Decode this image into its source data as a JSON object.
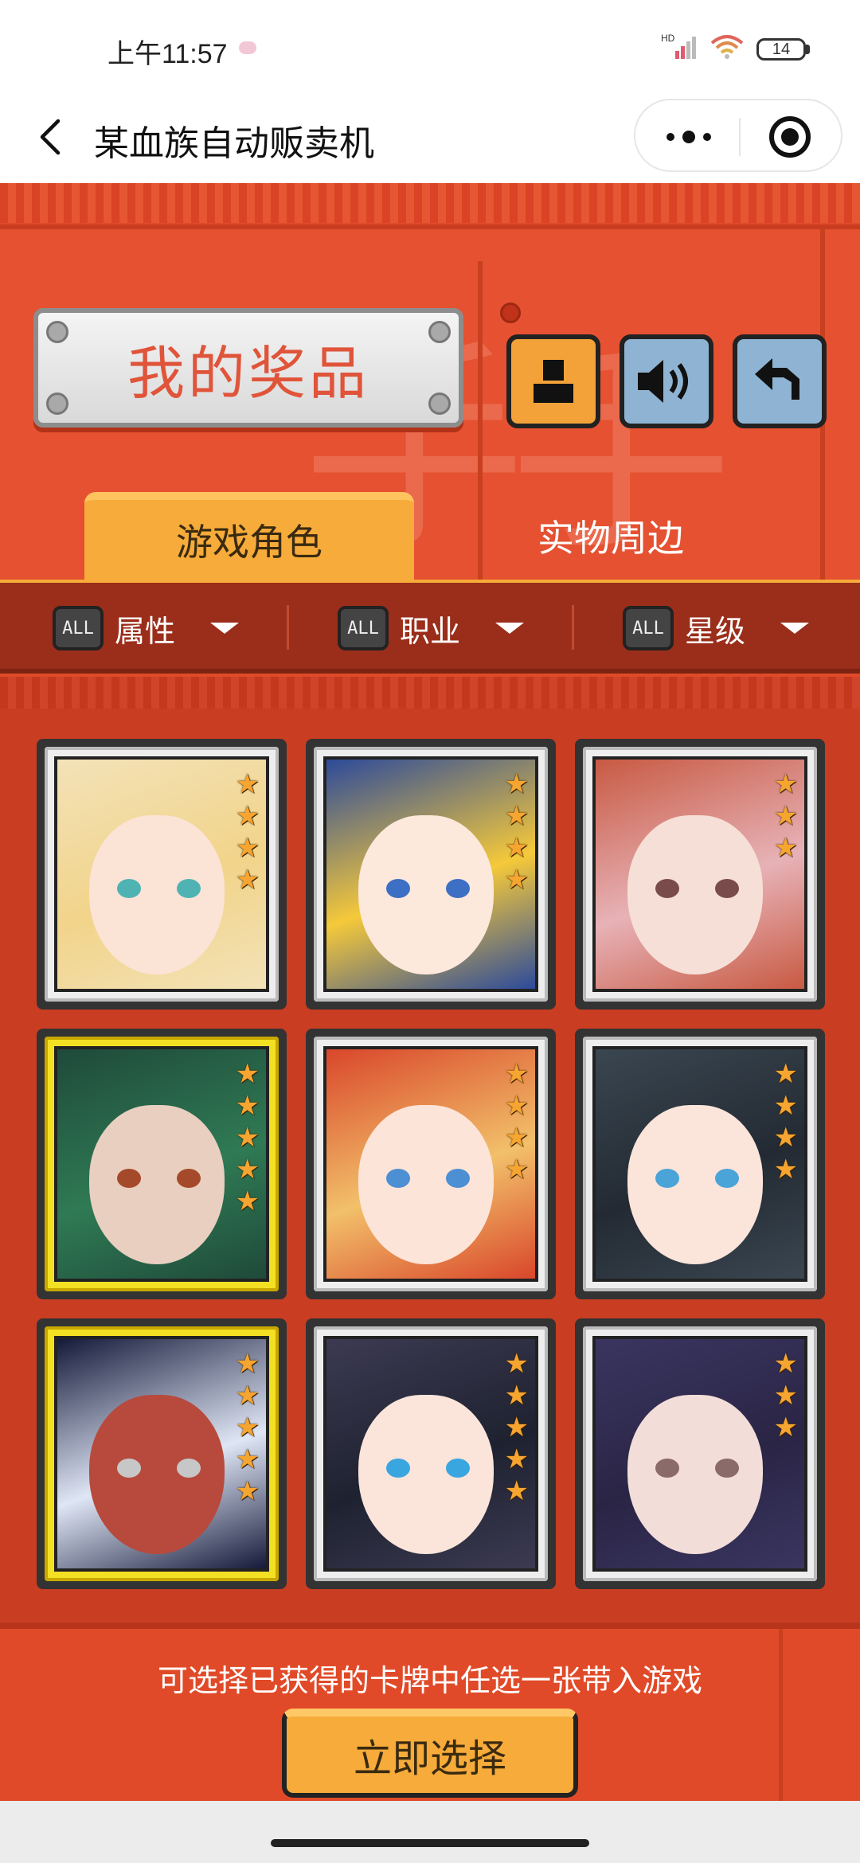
{
  "status_bar": {
    "time": "上午11:57",
    "signal_label": "HD",
    "battery": "14"
  },
  "nav": {
    "title": "某血族自动贩卖机"
  },
  "header": {
    "prize_label": "我的奖品"
  },
  "tabs": [
    {
      "label": "游戏角色",
      "active": true
    },
    {
      "label": "实物周边",
      "active": false
    }
  ],
  "filters": [
    {
      "badge": "ALL",
      "label": "属性"
    },
    {
      "badge": "ALL",
      "label": "职业"
    },
    {
      "badge": "ALL",
      "label": "星级"
    }
  ],
  "cards": [
    {
      "stars": 4,
      "frame": "silver",
      "palette": {
        "bg": "#f3e2b8",
        "hair": "#f2d48a",
        "skin": "#fbe3d6",
        "eye": "#4fb3b3"
      }
    },
    {
      "stars": 4,
      "frame": "silver",
      "palette": {
        "bg": "#2c4a9a",
        "hair": "#f5c93a",
        "skin": "#fde8dc",
        "eye": "#3d6fc4"
      }
    },
    {
      "stars": 3,
      "frame": "silver",
      "palette": {
        "bg": "#c85a43",
        "hair": "#e7b2b7",
        "skin": "#f6dfd6",
        "eye": "#7a4b4b"
      }
    },
    {
      "stars": 5,
      "frame": "gold",
      "palette": {
        "bg": "#1f4a3a",
        "hair": "#2f7a54",
        "skin": "#e9cfc0",
        "eye": "#a44a2a"
      }
    },
    {
      "stars": 4,
      "frame": "silver",
      "palette": {
        "bg": "#d9472b",
        "hair": "#f2c06a",
        "skin": "#fde4d8",
        "eye": "#4c8fd3"
      }
    },
    {
      "stars": 4,
      "frame": "silver",
      "palette": {
        "bg": "#3a4650",
        "hair": "#232a33",
        "skin": "#fbe4da",
        "eye": "#4aa4d8"
      }
    },
    {
      "stars": 5,
      "frame": "gold",
      "palette": {
        "bg": "#151a3a",
        "hair": "#dfe6f5",
        "skin": "#b74a3c",
        "eye": "#c7c7c7"
      }
    },
    {
      "stars": 5,
      "frame": "silver",
      "palette": {
        "bg": "#3c3a52",
        "hair": "#1e2230",
        "skin": "#fbe4da",
        "eye": "#3aa6e0"
      }
    },
    {
      "stars": 3,
      "frame": "silver",
      "palette": {
        "bg": "#3a3560",
        "hair": "#2a2545",
        "skin": "#f3ddd8",
        "eye": "#8b6a6a"
      }
    }
  ],
  "footer": {
    "hint": "可选择已获得的卡牌中任选一张带入游戏",
    "select_button": "立即选择"
  },
  "colors": {
    "brand_red": "#e14a28",
    "accent_orange": "#f6ab3a",
    "button_blue": "#8fb4d3"
  }
}
